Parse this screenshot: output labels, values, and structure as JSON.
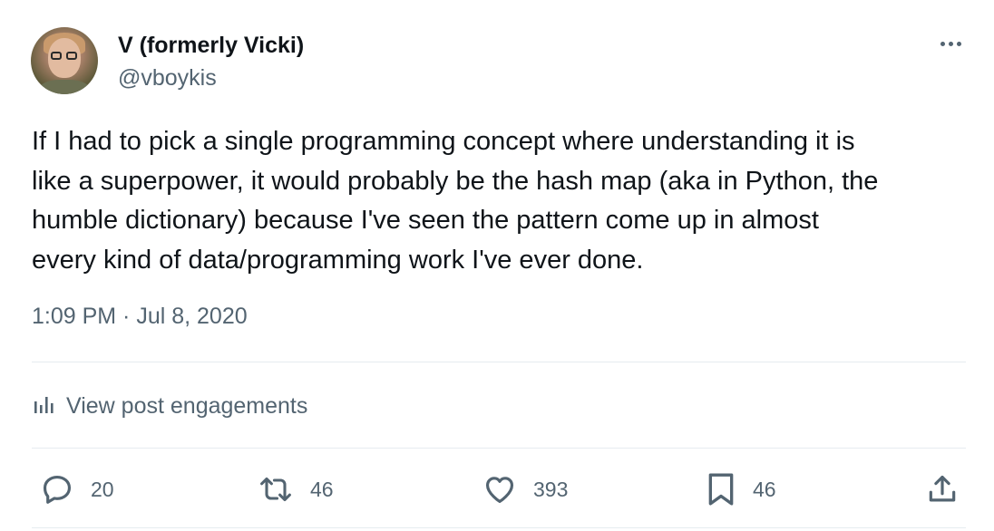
{
  "author": {
    "display_name": "V (formerly Vicki)",
    "handle": "@vboykis"
  },
  "tweet": {
    "text": "If I had to pick a single programming concept where understanding it is\nlike a superpower, it would probably be the hash map (aka in Python, the\nhumble dictionary) because I've seen the pattern come up in almost\nevery kind of data/programming work I've ever done.",
    "timestamp": "1:09 PM · Jul 8, 2020"
  },
  "engagements_label": "View post engagements",
  "actions": {
    "replies": "20",
    "reposts": "46",
    "likes": "393",
    "bookmarks": "46"
  },
  "icons": [
    "more-icon",
    "engagements-icon",
    "reply-icon",
    "repost-icon",
    "like-icon",
    "bookmark-icon",
    "share-icon"
  ],
  "colors": {
    "text": "#0f1419",
    "secondary": "#536471",
    "divider": "#e6ecf0"
  }
}
